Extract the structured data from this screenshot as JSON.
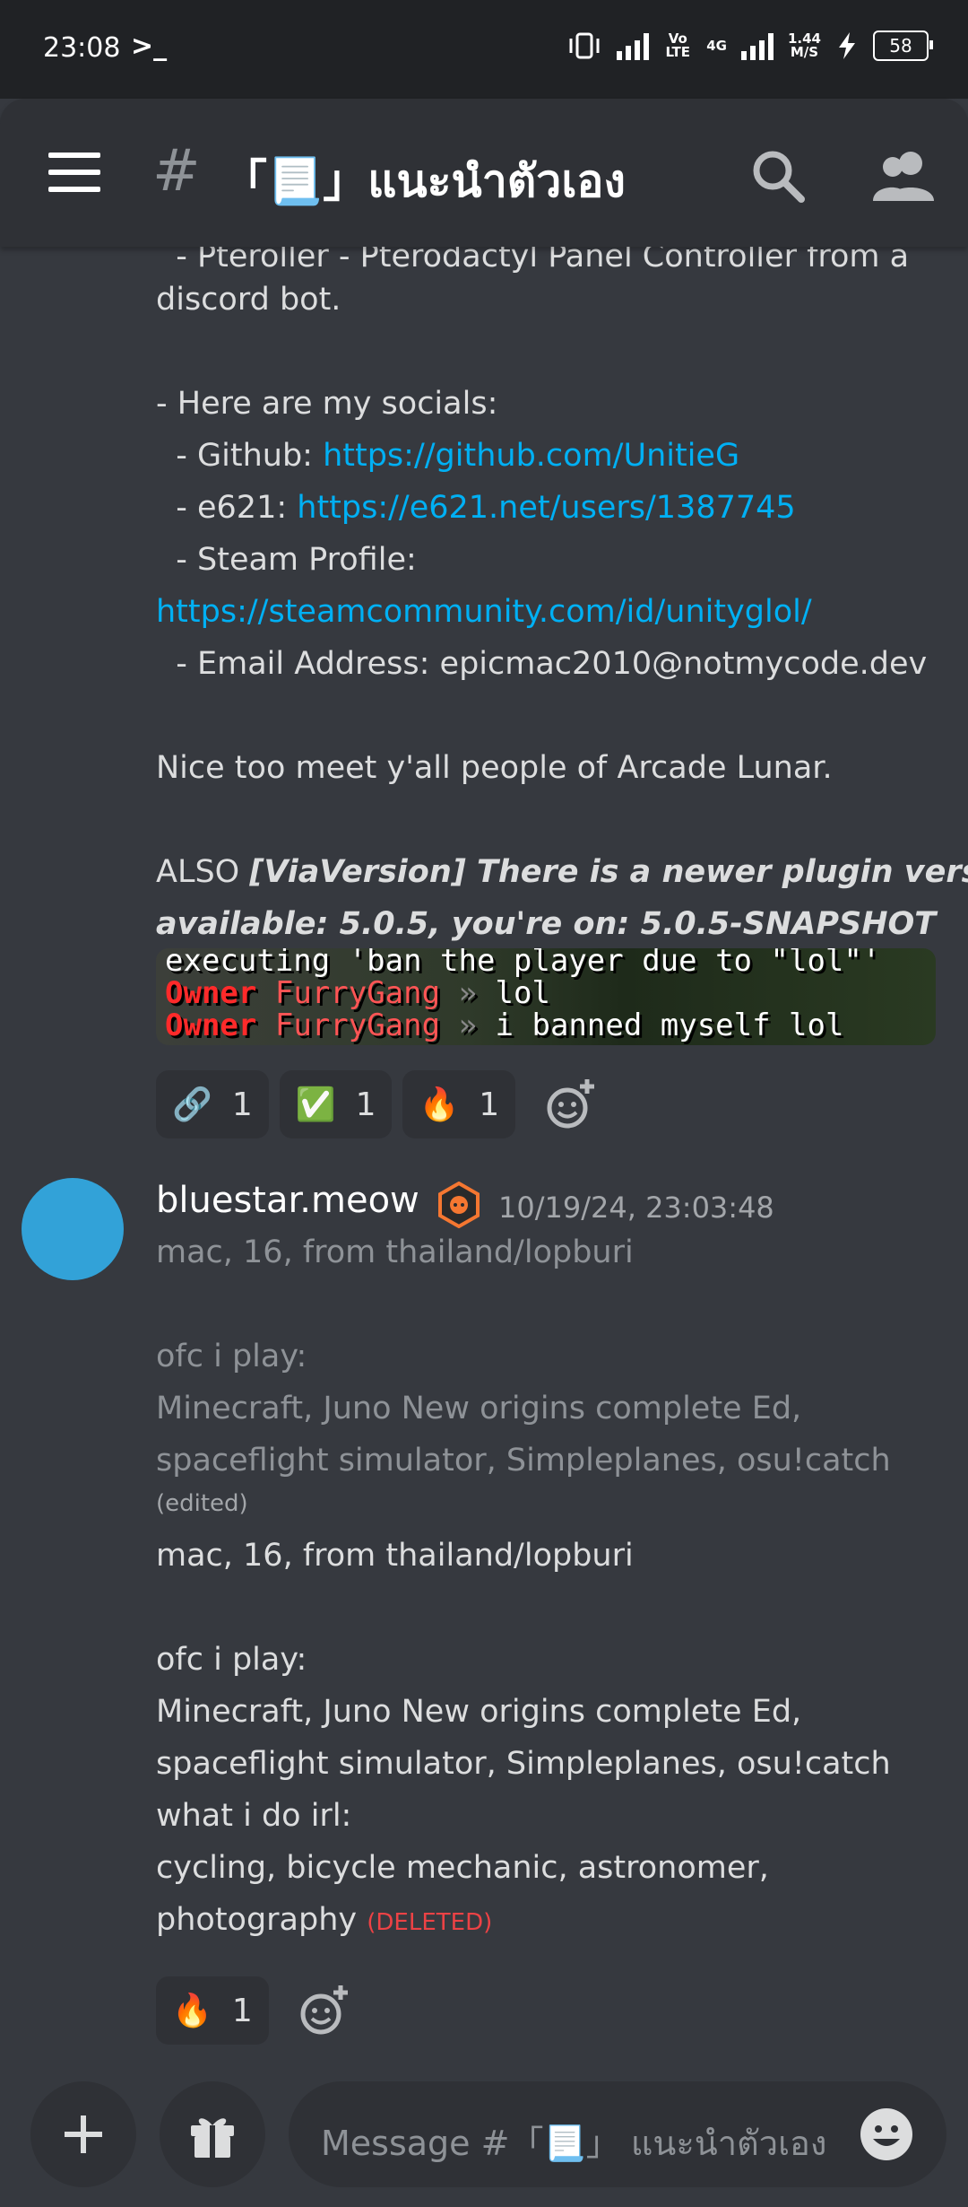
{
  "status_bar": {
    "time": "23:08",
    "terminal_icon": ">_",
    "volte": "Vo LTE",
    "network": "4G",
    "speed_value": "1.44",
    "speed_unit": "M/S",
    "battery": "58"
  },
  "header": {
    "channel_hash": "#",
    "channel_name": "「📃」แนะนำตัวเอง",
    "icons": [
      "hamburger-icon",
      "search-icon",
      "members-icon"
    ]
  },
  "messages": {
    "first": {
      "line_top": "  - Pteroller - Pterodactyl Panel Controller from a",
      "line_discord": "discord bot.",
      "socials_heading": "- Here are my socials:",
      "github_label": "  - Github: ",
      "github_link": "https://github.com/UnitieG",
      "e621_label": "  - e621: ",
      "e621_link": "https://e621.net/users/1387745",
      "steam_label": "  - Steam Profile:",
      "steam_link": "https://steamcommunity.com/id/unityglol/",
      "email_line": "  - Email Address: epicmac2010@notmycode.dev",
      "nice_line": "Nice too meet y'all people of Arcade Lunar.",
      "also_prefix": "ALSO ",
      "also_em1": "[ViaVersion] There is a newer plugin version",
      "also_em2": "available: 5.0.5, you're on: 5.0.5-SNAPSHOT",
      "image": {
        "line1": "executing 'ban the player due to \"lol\"'",
        "owner": "Owner",
        "name": "FurryGang",
        "sep": "»",
        "msg1": "lol",
        "msg2": "i banned myself lol"
      },
      "reactions": [
        {
          "emoji": "🔗",
          "count": "1"
        },
        {
          "emoji": "✅",
          "count": "1"
        },
        {
          "emoji": "🔥",
          "count": "1"
        }
      ]
    },
    "second": {
      "username": "bluestar.meow",
      "timestamp": "10/19/24, 23:03:48",
      "old": {
        "l1": "mac, 16, from thailand/lopburi",
        "l2": "ofc i play:",
        "l3": "Minecraft, Juno New origins complete Ed,",
        "l4": "spaceflight simulator, Simpleplanes, osu!catch",
        "edited": "(edited)"
      },
      "new": {
        "l1": "mac, 16, from thailand/lopburi",
        "l2": "ofc i play:",
        "l3": "Minecraft, Juno New origins complete Ed,",
        "l4": "spaceflight simulator, Simpleplanes, osu!catch",
        "l5": "what i do irl:",
        "l6": "cycling, bicycle mechanic, astronomer,",
        "l7": "photography",
        "deleted": "(DELETED)"
      },
      "reactions": [
        {
          "emoji": "🔥",
          "count": "1"
        }
      ]
    }
  },
  "input": {
    "placeholder": "Message #「📃」 แนะนำตัวเอง",
    "icons": [
      "plus-icon",
      "gift-icon",
      "emoji-icon"
    ]
  },
  "colors": {
    "background": "#36393f",
    "header": "#2f3136",
    "link": "#00b0f4",
    "deleted": "#ed4245",
    "avatar": "#32a2d8"
  }
}
